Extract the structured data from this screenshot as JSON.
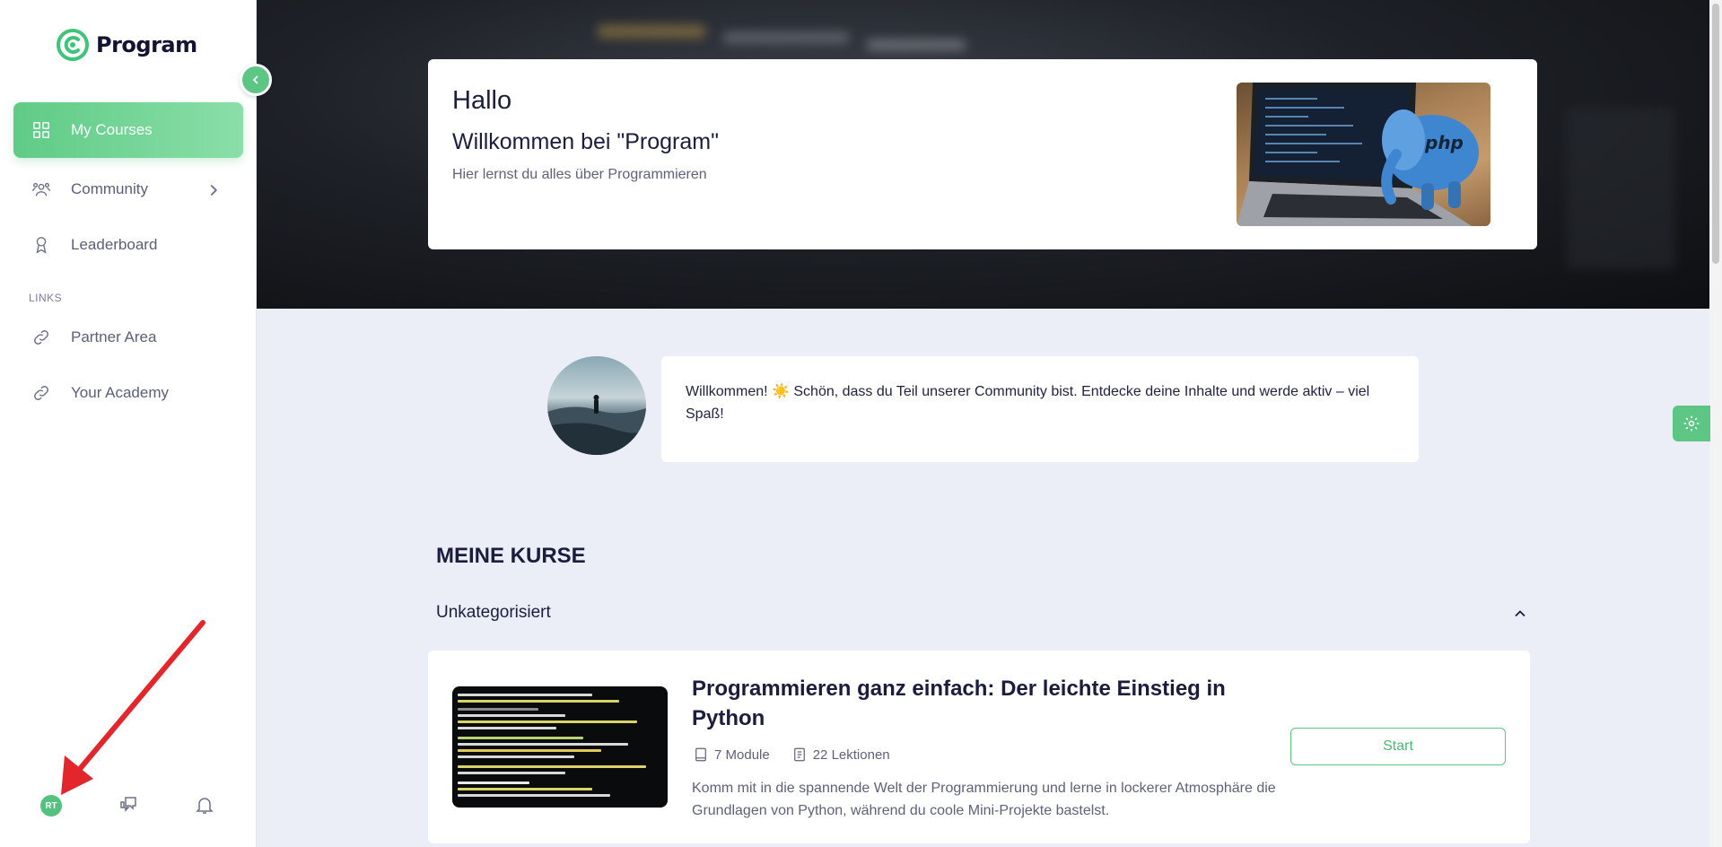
{
  "app": {
    "name": "Program"
  },
  "sidebar": {
    "items": [
      {
        "label": "My Courses",
        "icon": "grid-icon",
        "active": true
      },
      {
        "label": "Community",
        "icon": "users-icon",
        "has_submenu": true
      },
      {
        "label": "Leaderboard",
        "icon": "award-icon"
      }
    ],
    "links_header": "LINKS",
    "links": [
      {
        "label": "Partner Area",
        "icon": "link-icon"
      },
      {
        "label": "Your Academy",
        "icon": "link-icon"
      }
    ],
    "bottom": {
      "avatar_initials": "RT",
      "messages_icon": "chat-icon",
      "notifications_icon": "bell-icon"
    }
  },
  "hero": {
    "greeting": "Hallo",
    "welcome": "Willkommen bei \"Program\"",
    "subtitle": "Hier lernst du alles über Programmieren"
  },
  "welcome_message": {
    "text": "Willkommen! ☀️ Schön, dass du Teil unserer Community bist. Entdecke deine Inhalte und werde aktiv – viel Spaß!"
  },
  "courses": {
    "section_title": "MEINE KURSE",
    "category": "Unkategorisiert",
    "items": [
      {
        "title": "Programmieren ganz einfach: Der leichte Einstieg in Python",
        "modules": "7 Module",
        "lessons": "22 Lektionen",
        "description": "Komm mit in die spannende Welt der Programmierung und lerne in lockerer Atmosphäre die Grundlagen von Python, während du coole Mini-Projekte bastelst.",
        "button": "Start"
      }
    ]
  },
  "colors": {
    "accent": "#5dc685",
    "background": "#eceef7",
    "text": "#1a1d3d",
    "muted": "#5d6279",
    "annotation": "#e3262b"
  }
}
